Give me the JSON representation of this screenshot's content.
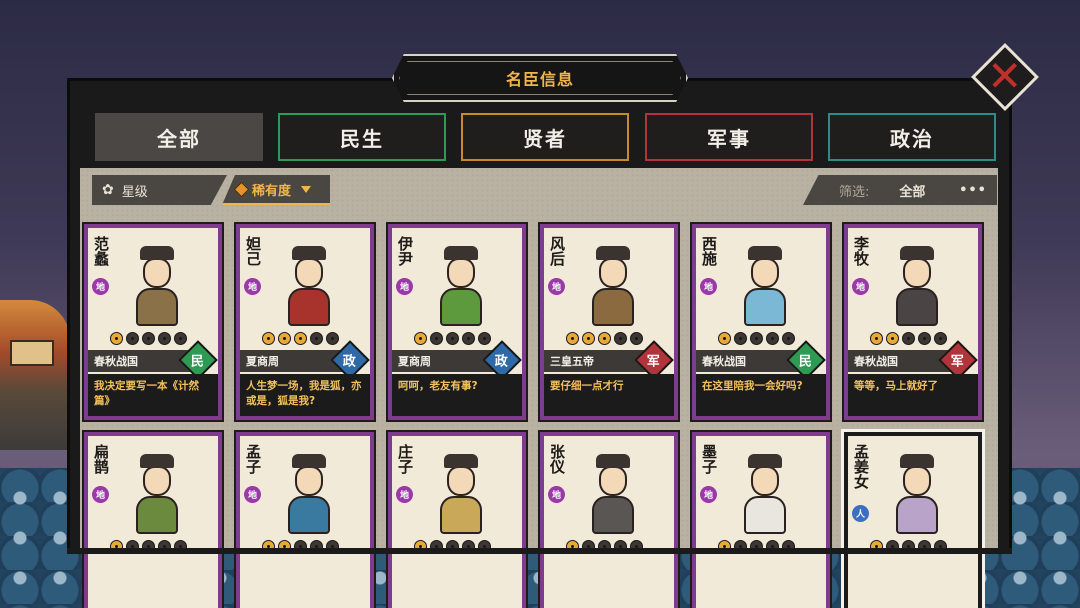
{
  "title": "名臣信息",
  "tabs": [
    {
      "label": "全部",
      "color": "#4a4744",
      "active": true
    },
    {
      "label": "民生",
      "color": "#2f9a53",
      "active": false
    },
    {
      "label": "贤者",
      "color": "#c98a2a",
      "active": false
    },
    {
      "label": "军事",
      "color": "#b0343a",
      "active": false
    },
    {
      "label": "政治",
      "color": "#2f8a8a",
      "active": false
    }
  ],
  "sort": {
    "star_label": "星级",
    "rarity_label": "稀有度"
  },
  "filter": {
    "label": "筛选:",
    "value": "全部",
    "more": "•••"
  },
  "category_colors": {
    "民": "#2f9a53",
    "政": "#2f6aa8",
    "军": "#b0343a"
  },
  "cards": [
    {
      "name": "范蠡",
      "grade": "地",
      "stars": 1,
      "era": "春秋战国",
      "category": "民",
      "quote": "我决定要写一本《计然篇》",
      "robe": "#8a7148",
      "selected": false
    },
    {
      "name": "妲己",
      "grade": "地",
      "stars": 3,
      "era": "夏商周",
      "category": "政",
      "quote": "人生梦一场，我是狐，亦或是，狐是我?",
      "robe": "#a8322c",
      "selected": false
    },
    {
      "name": "伊尹",
      "grade": "地",
      "stars": 1,
      "era": "夏商周",
      "category": "政",
      "quote": "呵呵，老友有事?",
      "robe": "#5d9a3d",
      "selected": false
    },
    {
      "name": "风后",
      "grade": "地",
      "stars": 3,
      "era": "三皇五帝",
      "category": "军",
      "quote": "要仔细一点才行",
      "robe": "#8a6a3e",
      "selected": false
    },
    {
      "name": "西施",
      "grade": "地",
      "stars": 1,
      "era": "春秋战国",
      "category": "民",
      "quote": "在这里陪我一会好吗?",
      "robe": "#7ab8d6",
      "selected": false
    },
    {
      "name": "李牧",
      "grade": "地",
      "stars": 2,
      "era": "春秋战国",
      "category": "军",
      "quote": "等等，马上就好了",
      "robe": "#4a4544",
      "selected": false
    },
    {
      "name": "扁鹊",
      "grade": "地",
      "stars": 1,
      "era": "",
      "category": "",
      "quote": "",
      "robe": "#6b8a3e",
      "selected": false
    },
    {
      "name": "孟子",
      "grade": "地",
      "stars": 2,
      "era": "",
      "category": "",
      "quote": "",
      "robe": "#3a7aa0",
      "selected": false
    },
    {
      "name": "庄子",
      "grade": "地",
      "stars": 1,
      "era": "",
      "category": "",
      "quote": "",
      "robe": "#c9a85a",
      "selected": false
    },
    {
      "name": "张仪",
      "grade": "地",
      "stars": 1,
      "era": "",
      "category": "",
      "quote": "",
      "robe": "#5a5654",
      "selected": false
    },
    {
      "name": "墨子",
      "grade": "地",
      "stars": 1,
      "era": "",
      "category": "",
      "quote": "",
      "robe": "#e9e6e0",
      "selected": false
    },
    {
      "name": "孟姜女",
      "grade": "人",
      "stars": 1,
      "era": "",
      "category": "",
      "quote": "",
      "robe": "#b9a3c8",
      "selected": true
    }
  ]
}
